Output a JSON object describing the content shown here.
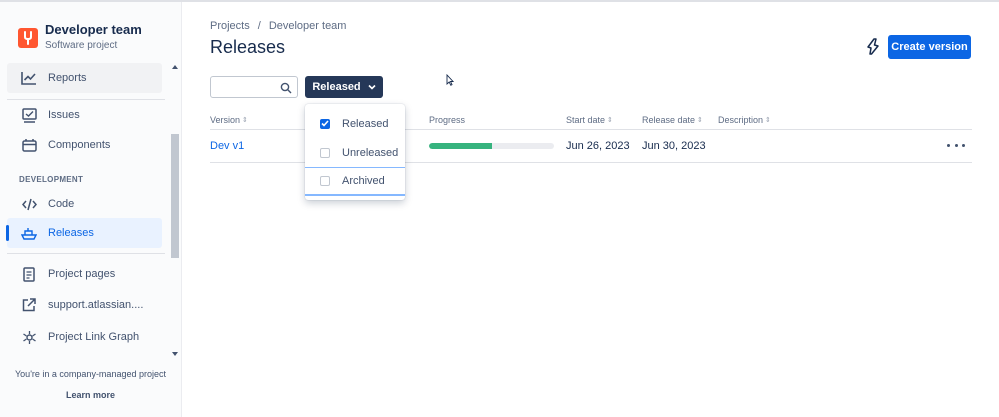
{
  "project": {
    "name": "Developer team",
    "type": "Software project"
  },
  "sidebar": {
    "items": [
      {
        "label": "Reports",
        "icon": "chart-line-icon"
      },
      {
        "label": "Issues",
        "icon": "issues-icon"
      },
      {
        "label": "Components",
        "icon": "components-icon"
      },
      {
        "label": "Code",
        "icon": "code-icon"
      },
      {
        "label": "Releases",
        "icon": "ship-icon"
      },
      {
        "label": "Project pages",
        "icon": "page-icon"
      },
      {
        "label": "support.atlassian....",
        "icon": "external-link-icon"
      },
      {
        "label": "Project Link Graph",
        "icon": "graph-icon"
      }
    ],
    "section_development": "DEVELOPMENT",
    "active_item": "Releases",
    "footer_text": "You're in a company-managed project",
    "footer_link": "Learn more"
  },
  "breadcrumb": {
    "items": [
      "Projects",
      "Developer team"
    ],
    "separator": "/"
  },
  "page": {
    "title": "Releases",
    "create_button": "Create version"
  },
  "filters": {
    "search_value": "",
    "search_placeholder": "",
    "status_button": "Released",
    "options": [
      {
        "label": "Released",
        "checked": true
      },
      {
        "label": "Unreleased",
        "checked": false
      },
      {
        "label": "Archived",
        "checked": false
      }
    ]
  },
  "table": {
    "columns": [
      "Version",
      "Progress",
      "Start date",
      "Release date",
      "Description"
    ],
    "rows": [
      {
        "version": "Dev v1",
        "progress": 0.5,
        "start_date": "Jun 26, 2023",
        "release_date": "Jun 30, 2023",
        "description": ""
      }
    ]
  },
  "colors": {
    "primary": "#0c66e4",
    "dark_button": "#253858",
    "progress_done": "#36b37e",
    "project_logo": "#ff5630"
  }
}
